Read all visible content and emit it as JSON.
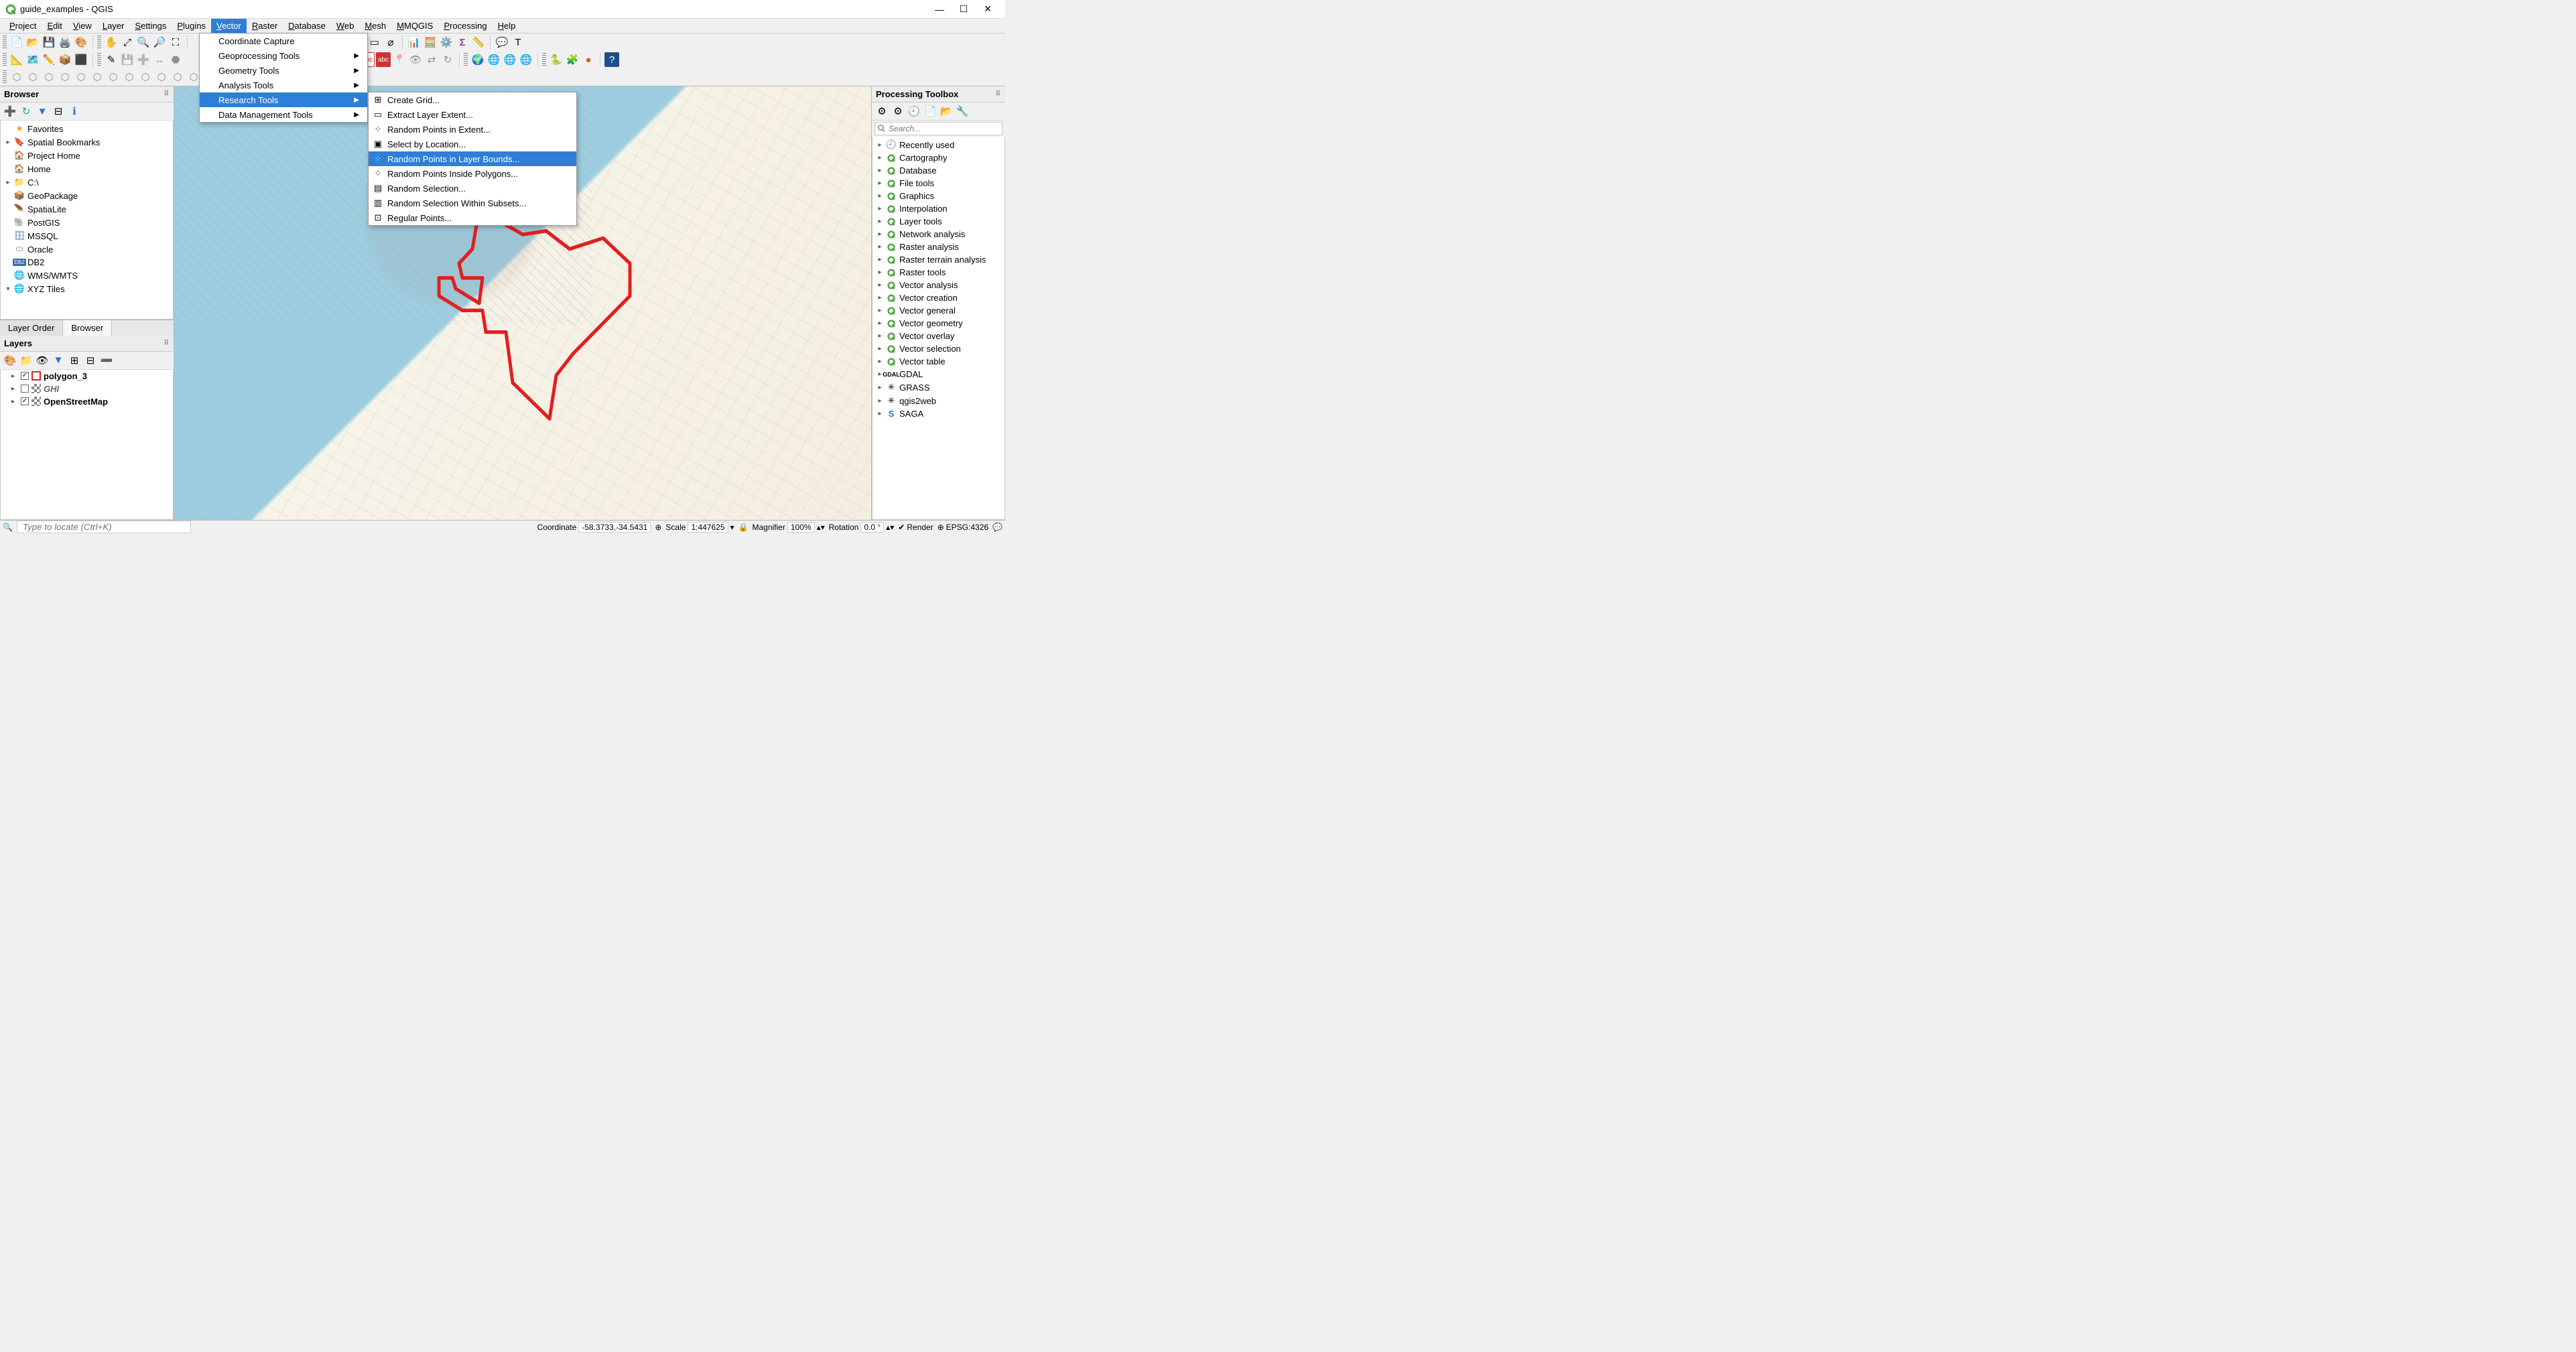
{
  "title": "guide_examples - QGIS",
  "menubar": [
    "Project",
    "Edit",
    "View",
    "Layer",
    "Settings",
    "Plugins",
    "Vector",
    "Raster",
    "Database",
    "Web",
    "Mesh",
    "MMQGIS",
    "Processing",
    "Help"
  ],
  "active_menu_index": 6,
  "vector_menu": {
    "items": [
      {
        "label": "Coordinate Capture",
        "submenu": false
      },
      {
        "label": "Geoprocessing Tools",
        "submenu": true
      },
      {
        "label": "Geometry Tools",
        "submenu": true
      },
      {
        "label": "Analysis Tools",
        "submenu": true
      },
      {
        "label": "Research Tools",
        "submenu": true,
        "highlight": true
      },
      {
        "label": "Data Management Tools",
        "submenu": true
      }
    ]
  },
  "research_submenu": {
    "items": [
      {
        "label": "Create Grid...",
        "icon": "grid"
      },
      {
        "label": "Extract Layer Extent...",
        "icon": "extent"
      },
      {
        "label": "Random Points in Extent...",
        "icon": "rand-pts"
      },
      {
        "label": "Select by Location...",
        "icon": "sel-loc"
      },
      {
        "label": "Random Points in Layer Bounds...",
        "icon": "rand-layer",
        "highlight": true
      },
      {
        "label": "Random Points Inside Polygons...",
        "icon": "rand-poly"
      },
      {
        "label": "Random Selection...",
        "icon": "rand-sel"
      },
      {
        "label": "Random Selection Within Subsets...",
        "icon": "rand-sub"
      },
      {
        "label": "Regular Points...",
        "icon": "reg-pts"
      }
    ]
  },
  "browser": {
    "title": "Browser",
    "tabs": [
      "Layer Order",
      "Browser"
    ],
    "active_tab": 0,
    "items": [
      {
        "icon": "star",
        "label": "Favorites",
        "color": "#f0a020"
      },
      {
        "icon": "bookmark",
        "label": "Spatial Bookmarks",
        "expander": "▸"
      },
      {
        "icon": "home-proj",
        "label": "Project Home",
        "color": "#5aa84e"
      },
      {
        "icon": "home",
        "label": "Home"
      },
      {
        "icon": "drive",
        "label": "C:\\",
        "expander": "▸"
      },
      {
        "icon": "geopkg",
        "label": "GeoPackage",
        "color": "#d69a3e"
      },
      {
        "icon": "spatialite",
        "label": "SpatiaLite",
        "color": "#3a6aa5"
      },
      {
        "icon": "postgis",
        "label": "PostGIS",
        "color": "#3a6aa5"
      },
      {
        "icon": "mssql",
        "label": "MSSQL",
        "color": "#3a6aa5"
      },
      {
        "icon": "oracle",
        "label": "Oracle",
        "color": "#3a6aa5"
      },
      {
        "icon": "db2",
        "label": "DB2",
        "badge": "DB2"
      },
      {
        "icon": "globe",
        "label": "WMS/WMTS",
        "color": "#3a6aa5"
      },
      {
        "icon": "globe",
        "label": "XYZ Tiles",
        "expander": "▾",
        "color": "#3a6aa5"
      }
    ]
  },
  "layers": {
    "title": "Layers",
    "rows": [
      {
        "checked": true,
        "name": "polygon_3",
        "style": "outline",
        "expander": "▸"
      },
      {
        "checked": false,
        "name": "GHI",
        "style": "raster",
        "italic": true,
        "expander": "▸"
      },
      {
        "checked": true,
        "name": "OpenStreetMap",
        "style": "raster",
        "expander": "▸"
      }
    ]
  },
  "processing": {
    "title": "Processing Toolbox",
    "search_placeholder": "Search...",
    "items": [
      {
        "icon": "clock",
        "label": "Recently used"
      },
      {
        "icon": "q",
        "label": "Cartography"
      },
      {
        "icon": "q",
        "label": "Database"
      },
      {
        "icon": "q",
        "label": "File tools"
      },
      {
        "icon": "q",
        "label": "Graphics"
      },
      {
        "icon": "q",
        "label": "Interpolation"
      },
      {
        "icon": "q",
        "label": "Layer tools"
      },
      {
        "icon": "q",
        "label": "Network analysis"
      },
      {
        "icon": "q",
        "label": "Raster analysis"
      },
      {
        "icon": "q",
        "label": "Raster terrain analysis"
      },
      {
        "icon": "q",
        "label": "Raster tools"
      },
      {
        "icon": "q",
        "label": "Vector analysis"
      },
      {
        "icon": "q",
        "label": "Vector creation"
      },
      {
        "icon": "q",
        "label": "Vector general"
      },
      {
        "icon": "q",
        "label": "Vector geometry"
      },
      {
        "icon": "q",
        "label": "Vector overlay"
      },
      {
        "icon": "q",
        "label": "Vector selection"
      },
      {
        "icon": "q",
        "label": "Vector table"
      },
      {
        "icon": "gdal",
        "label": "GDAL"
      },
      {
        "icon": "grass",
        "label": "GRASS"
      },
      {
        "icon": "web",
        "label": "qgis2web"
      },
      {
        "icon": "saga",
        "label": "SAGA"
      }
    ]
  },
  "statusbar": {
    "locator_placeholder": "Type to locate (Ctrl+K)",
    "coord_label": "Coordinate",
    "coord_value": "-58.3733,-34.5431",
    "scale_label": "Scale",
    "scale_value": "1:447625",
    "magnifier_label": "Magnifier",
    "magnifier_value": "100%",
    "rotation_label": "Rotation",
    "rotation_value": "0.0 °",
    "render_label": "Render",
    "crs_value": "EPSG:4326"
  },
  "colors": {
    "accent": "#2f7ed8",
    "polygon": "#e02020"
  }
}
